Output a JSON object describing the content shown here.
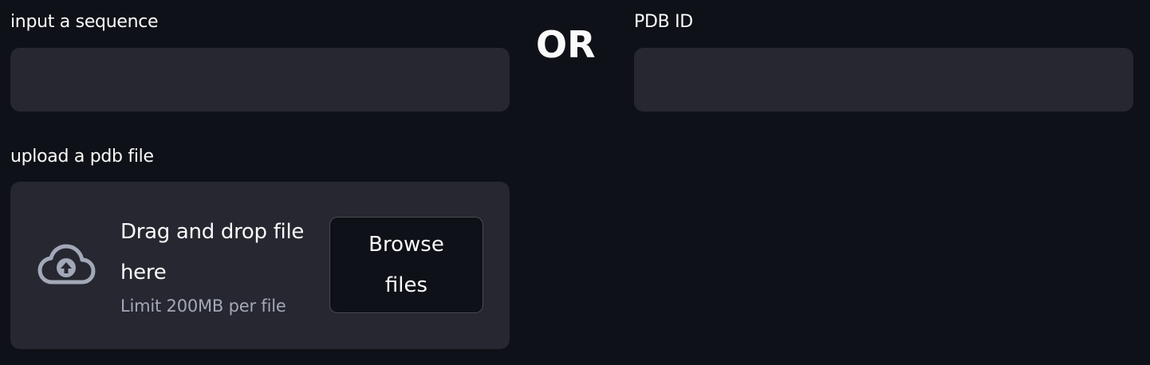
{
  "sequence": {
    "label": "input a sequence",
    "value": "",
    "placeholder": ""
  },
  "separator": {
    "text": "OR"
  },
  "pdb_id": {
    "label": "PDB ID",
    "value": "",
    "placeholder": ""
  },
  "upload": {
    "label": "upload a pdb file",
    "dropzone_title": "Drag and drop file here",
    "limit_text": "Limit 200MB per file",
    "browse_label": "Browse files",
    "icon": "cloud-upload-icon"
  },
  "colors": {
    "background": "#0e1117",
    "input_bg": "#262730",
    "text": "#fafafa",
    "muted_text": "#a3a8b8",
    "icon": "#a3a8b8"
  }
}
